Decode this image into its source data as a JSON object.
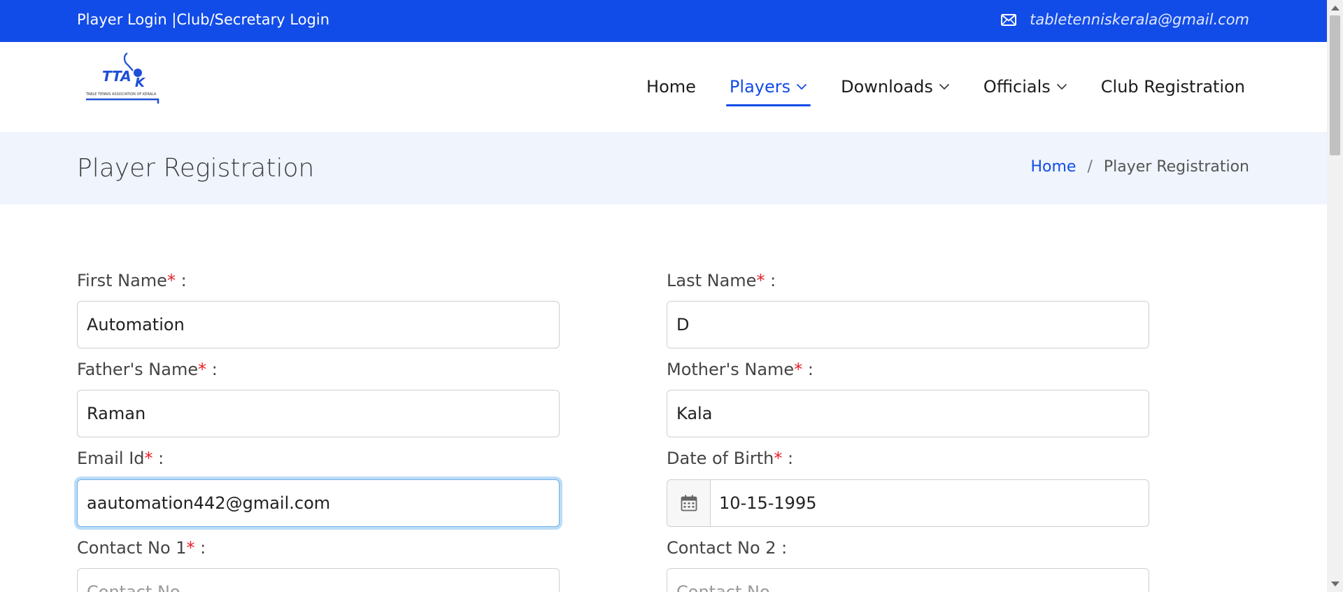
{
  "topbar": {
    "player_login": "Player Login",
    "separator": "|",
    "club_login": "Club/Secretary Login",
    "email": "tabletenniskerala@gmail.com",
    "bg_color": "#124ce8"
  },
  "logo": {
    "text": "TTAK",
    "caption": "TABLE TENNIS ASSOCIATION OF KERALA"
  },
  "nav": {
    "items": [
      {
        "label": "Home",
        "dropdown": false,
        "active": false
      },
      {
        "label": "Players",
        "dropdown": true,
        "active": true
      },
      {
        "label": "Downloads",
        "dropdown": true,
        "active": false
      },
      {
        "label": "Officials",
        "dropdown": true,
        "active": false
      },
      {
        "label": "Club Registration",
        "dropdown": false,
        "active": false
      }
    ]
  },
  "page": {
    "title": "Player Registration",
    "breadcrumb": {
      "home": "Home",
      "separator": "/",
      "current": "Player Registration"
    }
  },
  "form": {
    "required_mark": "*",
    "first_name": {
      "label": "First Name",
      "suffix": " :",
      "value": "Automation"
    },
    "last_name": {
      "label": "Last Name",
      "suffix": " :",
      "value": "D"
    },
    "father_name": {
      "label": "Father's Name",
      "suffix": " :",
      "value": "Raman"
    },
    "mother_name": {
      "label": "Mother's Name",
      "suffix": " :",
      "value": "Kala"
    },
    "email": {
      "label": "Email Id",
      "suffix": " :",
      "value": "aautomation442@gmail.com"
    },
    "dob": {
      "label": "Date of Birth",
      "suffix": " :",
      "value": "10-15-1995",
      "icon": "calendar-icon"
    },
    "contact1": {
      "label": "Contact No 1",
      "suffix": " :",
      "placeholder": "Contact No"
    },
    "contact2": {
      "label": "Contact No 2 :",
      "placeholder": "Contact No"
    }
  },
  "colors": {
    "accent": "#124ce8",
    "required": "#e8202a",
    "band": "#eff4fd"
  }
}
